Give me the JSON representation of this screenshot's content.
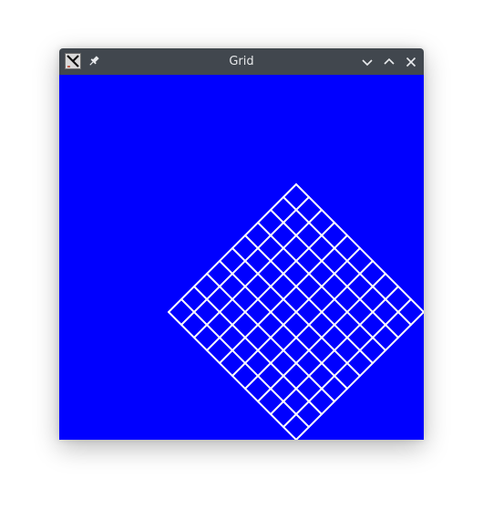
{
  "window": {
    "title": "Grid",
    "canvas_color": "#0000ff",
    "grid_color": "#ffffff",
    "titlebar_color": "#41474e"
  },
  "icons": {
    "app": "x-window-icon",
    "pin": "pin-icon",
    "minimize": "chevron-down-icon",
    "maximize": "chevron-up-icon",
    "close": "close-icon"
  },
  "grid": {
    "cells_per_side": 10,
    "rotation_degrees": 45
  }
}
